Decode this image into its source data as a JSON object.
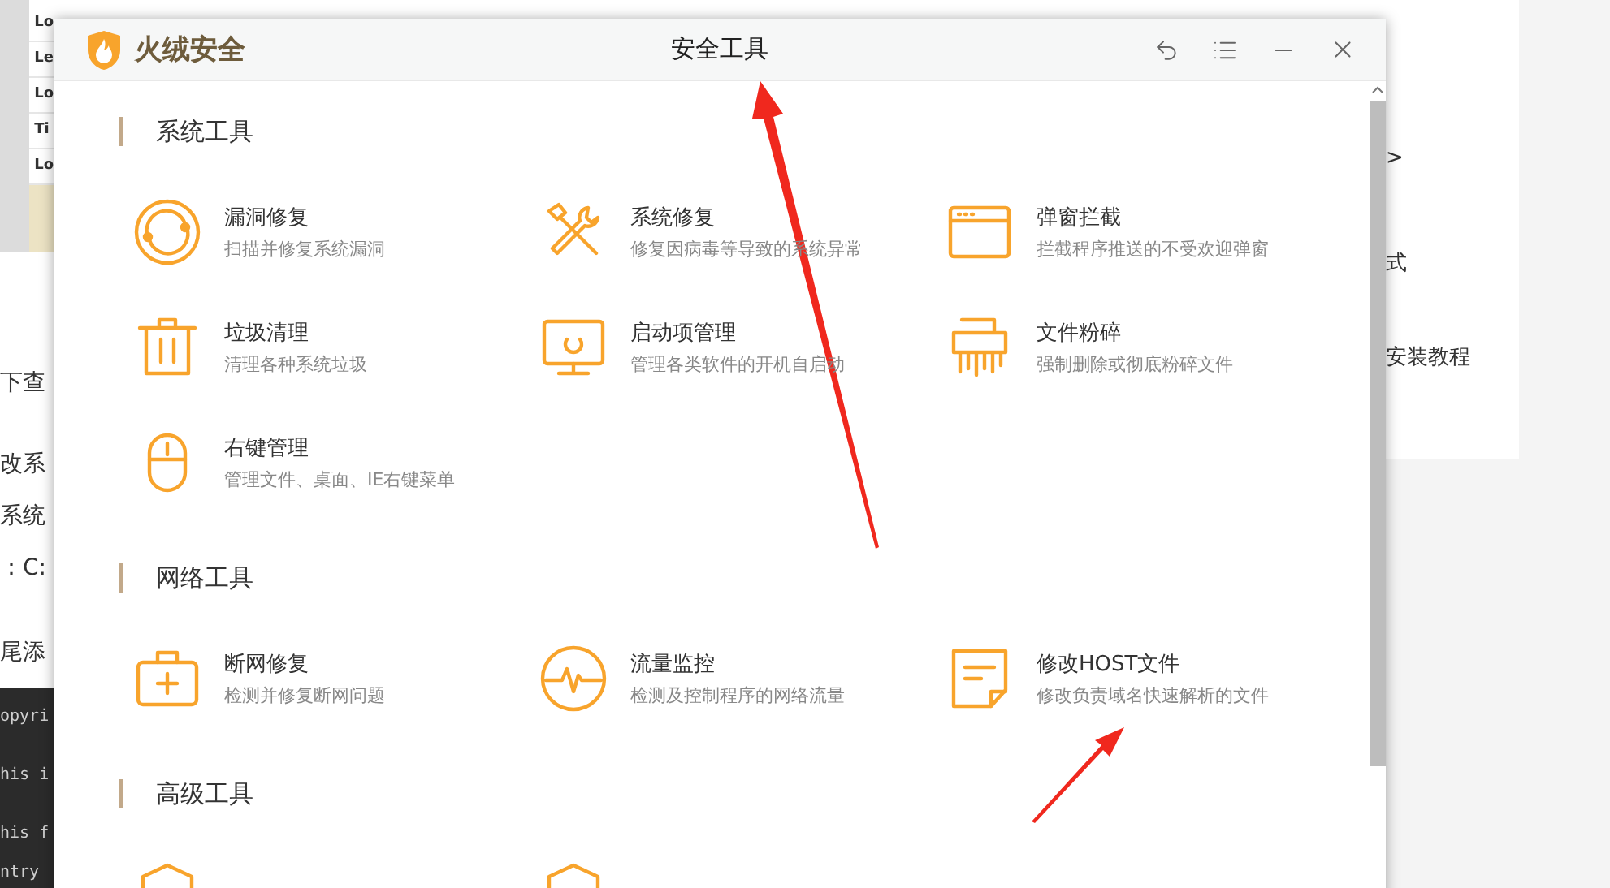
{
  "background_page": {
    "table_cells": [
      "Lo",
      "Le",
      "Lo",
      "Ti",
      "Lo"
    ],
    "text_fragments": [
      "下查",
      "改系",
      "系统",
      "：C:",
      "尾添"
    ],
    "code_lines": [
      "opyri",
      "his i",
      "his f",
      "ntry"
    ],
    "right_texts": [
      ">",
      "式",
      "安装教程"
    ]
  },
  "window": {
    "brand": "火绒安全",
    "title": "安全工具"
  },
  "sections": [
    {
      "title": "系统工具",
      "tools": [
        {
          "kind": "vulnerability",
          "name": "漏洞修复",
          "description": "扫描并修复系统漏洞"
        },
        {
          "kind": "repair",
          "name": "系统修复",
          "description": "修复因病毒等导致的系统异常"
        },
        {
          "kind": "popup",
          "name": "弹窗拦截",
          "description": "拦截程序推送的不受欢迎弹窗"
        },
        {
          "kind": "trash",
          "name": "垃圾清理",
          "description": "清理各种系统垃圾"
        },
        {
          "kind": "startup",
          "name": "启动项管理",
          "description": "管理各类软件的开机自启动"
        },
        {
          "kind": "shredder",
          "name": "文件粉碎",
          "description": "强制删除或彻底粉碎文件"
        },
        {
          "kind": "mouse",
          "name": "右键管理",
          "description": "管理文件、桌面、IE右键菜单"
        }
      ]
    },
    {
      "title": "网络工具",
      "tools": [
        {
          "kind": "firstaid",
          "name": "断网修复",
          "description": "检测并修复断网问题"
        },
        {
          "kind": "traffic",
          "name": "流量监控",
          "description": "检测及控制程序的网络流量"
        },
        {
          "kind": "hosts",
          "name": "修改HOST文件",
          "description": "修改负责域名快速解析的文件"
        }
      ]
    },
    {
      "title": "高级工具",
      "tools": [
        {
          "kind": "shield"
        },
        {
          "kind": "shield"
        }
      ]
    }
  ]
}
